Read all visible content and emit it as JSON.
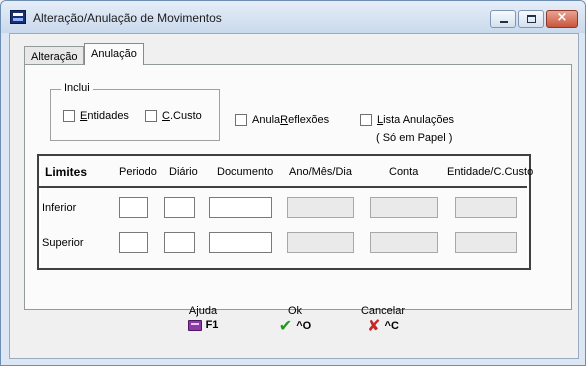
{
  "window": {
    "title": "Alteração/Anulação de Movimentos",
    "min_glyph": "",
    "max_glyph": "",
    "close_glyph": "×"
  },
  "tabs": [
    {
      "label": "Alteração",
      "active": false
    },
    {
      "label": "Anulação",
      "active": true
    }
  ],
  "inclui": {
    "label": "Inclui",
    "entidades": {
      "pre": "",
      "u": "E",
      "post": "ntidades",
      "checked": false
    },
    "ccusto": {
      "pre": "",
      "u": "C",
      "post": ".Custo",
      "checked": false
    }
  },
  "options": {
    "anula": {
      "pre": "Anula ",
      "u": "R",
      "post": "eflexões",
      "checked": false
    },
    "lista": {
      "pre": "",
      "u": "L",
      "post": "ista Anulações",
      "checked": false
    },
    "lista_note": "( Só em Papel )"
  },
  "limits": {
    "title": "Limites",
    "headers": [
      "Periodo",
      "Diário",
      "Documento",
      "Ano/Mês/Dia",
      "Conta",
      "Entidade/C.Custo"
    ],
    "rows": [
      {
        "label": "Inferior",
        "values": [
          "",
          "",
          "",
          "",
          "",
          ""
        ]
      },
      {
        "label": "Superior",
        "values": [
          "",
          "",
          "",
          "",
          "",
          ""
        ]
      }
    ]
  },
  "buttons": {
    "help": {
      "label": "Ajuda",
      "key": "F1",
      "icon": "book-icon"
    },
    "ok": {
      "label": "Ok",
      "key": "^O",
      "icon": "check-icon"
    },
    "cancel": {
      "label": "Cancelar",
      "key": "^C",
      "icon": "x-icon"
    }
  }
}
